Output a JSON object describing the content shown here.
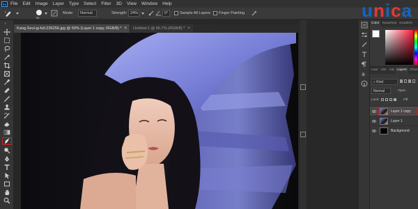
{
  "app": {
    "logo_text": "Ps",
    "menu": [
      "File",
      "Edit",
      "Image",
      "Layer",
      "Type",
      "Select",
      "Filter",
      "3D",
      "View",
      "Window",
      "Help"
    ]
  },
  "options_bar": {
    "brush_size": "56",
    "mode_label": "Mode:",
    "mode_value": "Normal",
    "strength_label": "Strength:",
    "strength_value": "24%",
    "angle_value": "0°",
    "sample_all_layers": "Sample All Layers",
    "finger_painting": "Finger Painting"
  },
  "brand": {
    "text": "unica",
    "colors": [
      "#1565c0",
      "#e53935",
      "#1565c0",
      "#e53935",
      "#1565c0"
    ]
  },
  "documents": {
    "tabs": [
      {
        "label": "Kang.Seul-gi.full.236256.jpg @ 50% (Layer 1 copy, RGB/8) *",
        "active": true
      },
      {
        "label": "Untitled-1 @ 66.7% (RGB/8) *",
        "active": false
      }
    ],
    "close_glyph": "×"
  },
  "panels": {
    "color_tabs": [
      "Color",
      "Swatches",
      "Gradient"
    ],
    "layer_tabs": [
      "Laer",
      "Libr",
      "Adj",
      "Layers",
      "Chan"
    ],
    "kind_label": "Kind",
    "blend_mode": "Normal",
    "opacity_label": "Opac",
    "lock_label": "Lock:",
    "fill_label": "Fill",
    "layers": [
      {
        "name": "Layer 1 copy",
        "selected": true,
        "visible": true
      },
      {
        "name": "Layer 1",
        "selected": false,
        "visible": true
      },
      {
        "name": "Background",
        "selected": false,
        "visible": true
      }
    ]
  },
  "toolbar": {
    "tools": [
      "move-icon",
      "marquee-icon",
      "lasso-icon",
      "magic-wand-icon",
      "crop-icon",
      "frame-icon",
      "eyedropper-icon",
      "healing-brush-icon",
      "brush-icon",
      "clone-stamp-icon",
      "history-brush-icon",
      "eraser-icon",
      "gradient-icon",
      "smudge-icon",
      "dodge-icon",
      "pen-icon",
      "type-icon",
      "path-selection-icon",
      "rectangle-icon",
      "hand-icon",
      "zoom-icon"
    ],
    "active_tool": "smudge-icon",
    "highlight_color": "#d42020"
  }
}
